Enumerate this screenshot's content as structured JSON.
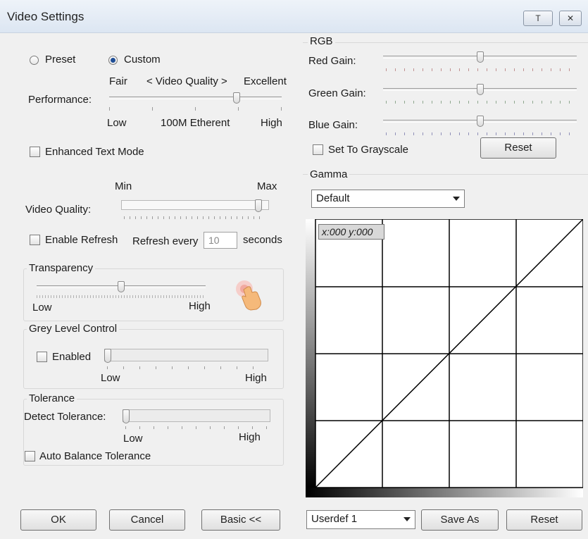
{
  "window": {
    "title": "Video Settings",
    "btn_pin": "T",
    "btn_close": "✕"
  },
  "mode": {
    "preset": "Preset",
    "custom": "Custom",
    "selected": "custom"
  },
  "performance": {
    "label": "Performance:",
    "fair": "Fair",
    "center": "< Video Quality >",
    "excellent": "Excellent",
    "low": "Low",
    "mid": "100M Etherent",
    "high": "High",
    "value": 0.75
  },
  "enhanced_text": {
    "label": "Enhanced Text Mode",
    "checked": false
  },
  "video_quality": {
    "label": "Video Quality:",
    "min": "Min",
    "max": "Max",
    "value": 0.95
  },
  "refresh": {
    "enable_label": "Enable Refresh",
    "every_label": "Refresh every",
    "value": "10",
    "unit": "seconds",
    "checked": false
  },
  "transparency": {
    "title": "Transparency",
    "low": "Low",
    "high": "High",
    "value": 0.5
  },
  "grey_level": {
    "title": "Grey Level Control",
    "enabled_label": "Enabled",
    "low": "Low",
    "high": "High",
    "value": 0.0,
    "checked": false
  },
  "tolerance": {
    "title": "Tolerance",
    "detect_label": "Detect Tolerance:",
    "low": "Low",
    "high": "High",
    "value": 0.0,
    "auto_label": "Auto Balance Tolerance",
    "checked": false
  },
  "rgb": {
    "title": "RGB",
    "red_label": "Red Gain:",
    "green_label": "Green Gain:",
    "blue_label": "Blue Gain:",
    "red_value": 0.5,
    "green_value": 0.5,
    "blue_value": 0.5,
    "grayscale_label": "Set To Grayscale",
    "reset_label": "Reset"
  },
  "gamma": {
    "title": "Gamma",
    "preset_value": "Default",
    "coord_readout": "x:000 y:000",
    "userdef_value": "Userdef 1",
    "save_as_label": "Save As",
    "reset_label": "Reset"
  },
  "footer": {
    "ok": "OK",
    "cancel": "Cancel",
    "basic": "Basic <<"
  }
}
